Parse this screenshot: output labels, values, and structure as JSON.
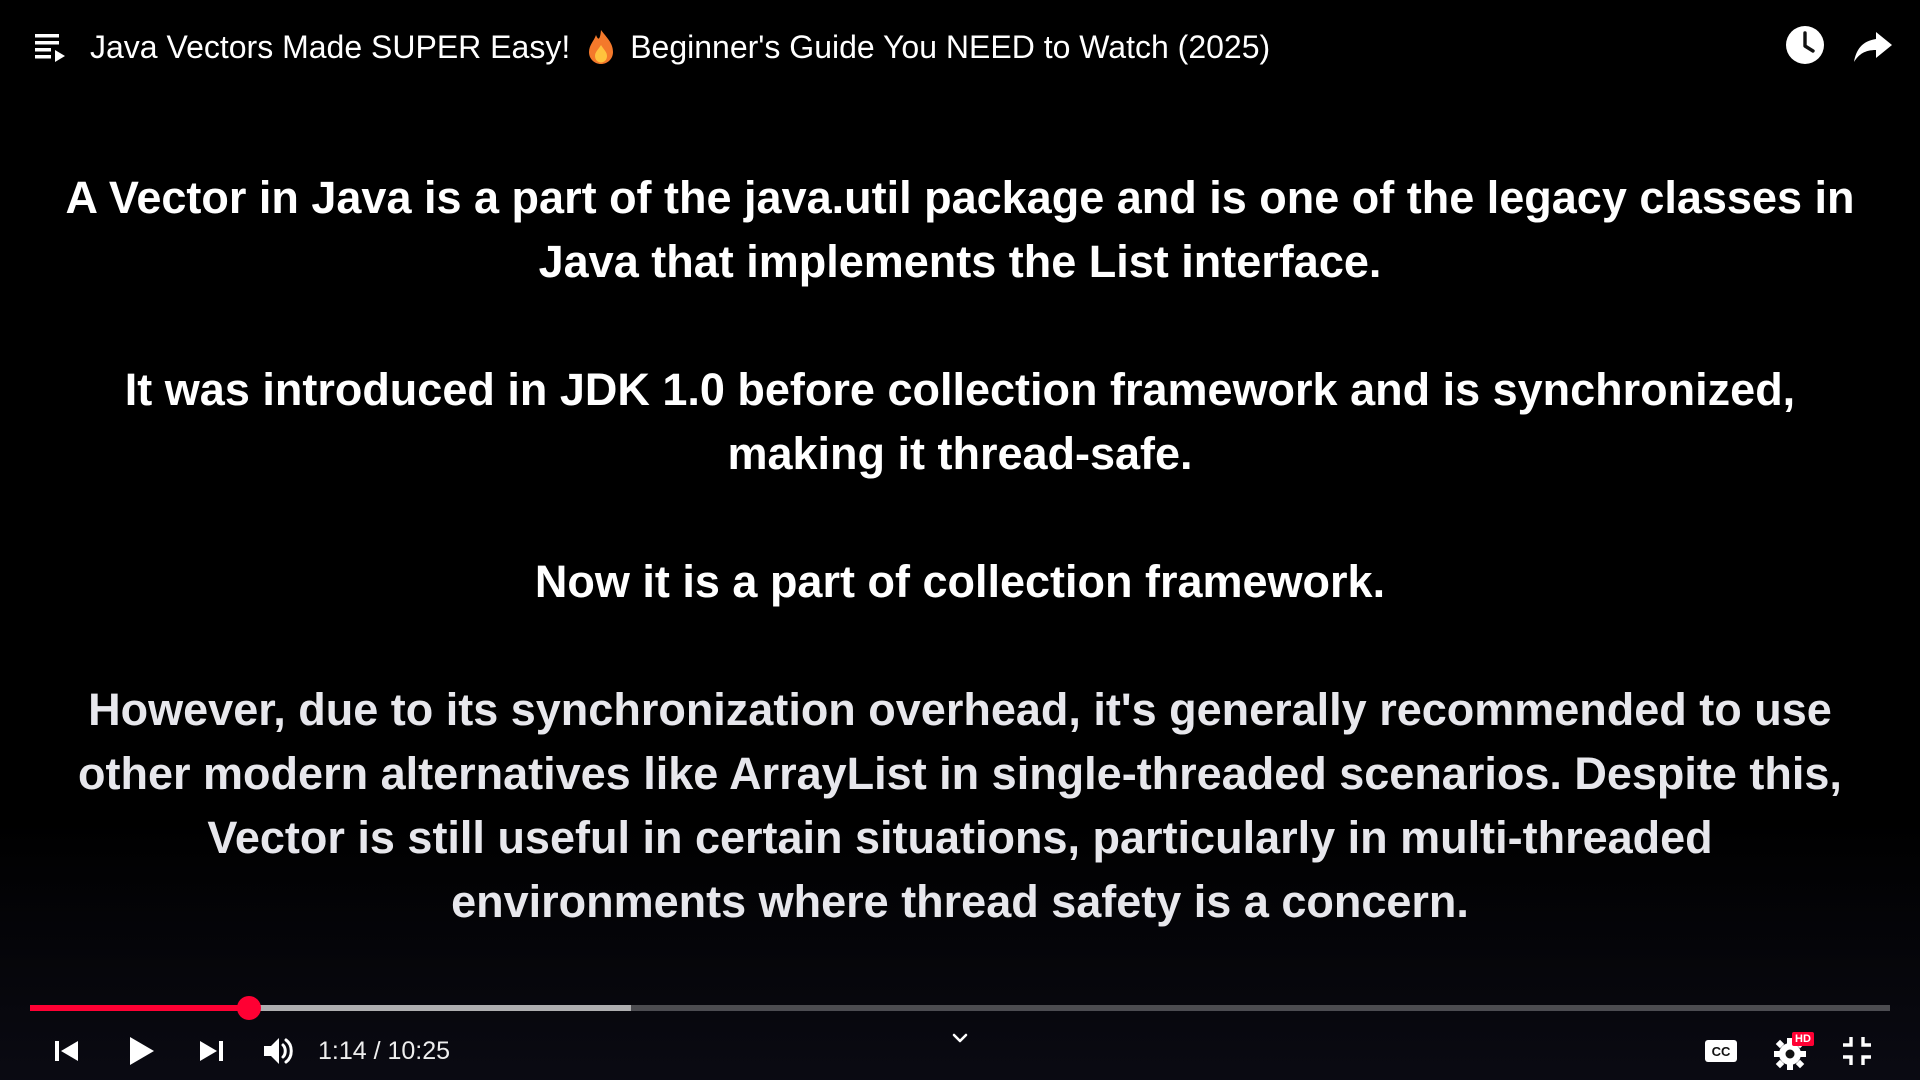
{
  "top_bar": {
    "title_part1": "Java Vectors Made SUPER Easy!",
    "title_emoji_icon": "fire-icon",
    "title_part2": "Beginner's Guide You NEED to Watch (2025)",
    "icons": [
      "playlist-icon",
      "watch-later-icon",
      "share-icon"
    ]
  },
  "slide": {
    "paragraphs": [
      "A Vector in Java is a part of the java.util package and is one of the legacy classes in Java that implements the List interface.",
      "It was introduced in JDK 1.0 before collection framework and is synchronized, making it thread-safe.",
      "Now it is a part of collection framework.",
      "However, due to its synchronization overhead, it's generally recommended to use other modern alternatives like ArrayList in single-threaded scenarios. Despite this, Vector is still useful in certain situations, particularly in multi-threaded environments where thread safety is a concern."
    ]
  },
  "player": {
    "time_display": "1:14 / 10:25",
    "progress_played_fraction": 0.118,
    "progress_buffered_fraction": 0.323,
    "hd_badge": "HD",
    "accent_color": "#ff0033",
    "icons": [
      "previous-icon",
      "play-icon",
      "next-icon",
      "volume-icon",
      "chevron-down-icon",
      "cc-icon",
      "settings-icon",
      "fullscreen-exit-icon"
    ]
  }
}
